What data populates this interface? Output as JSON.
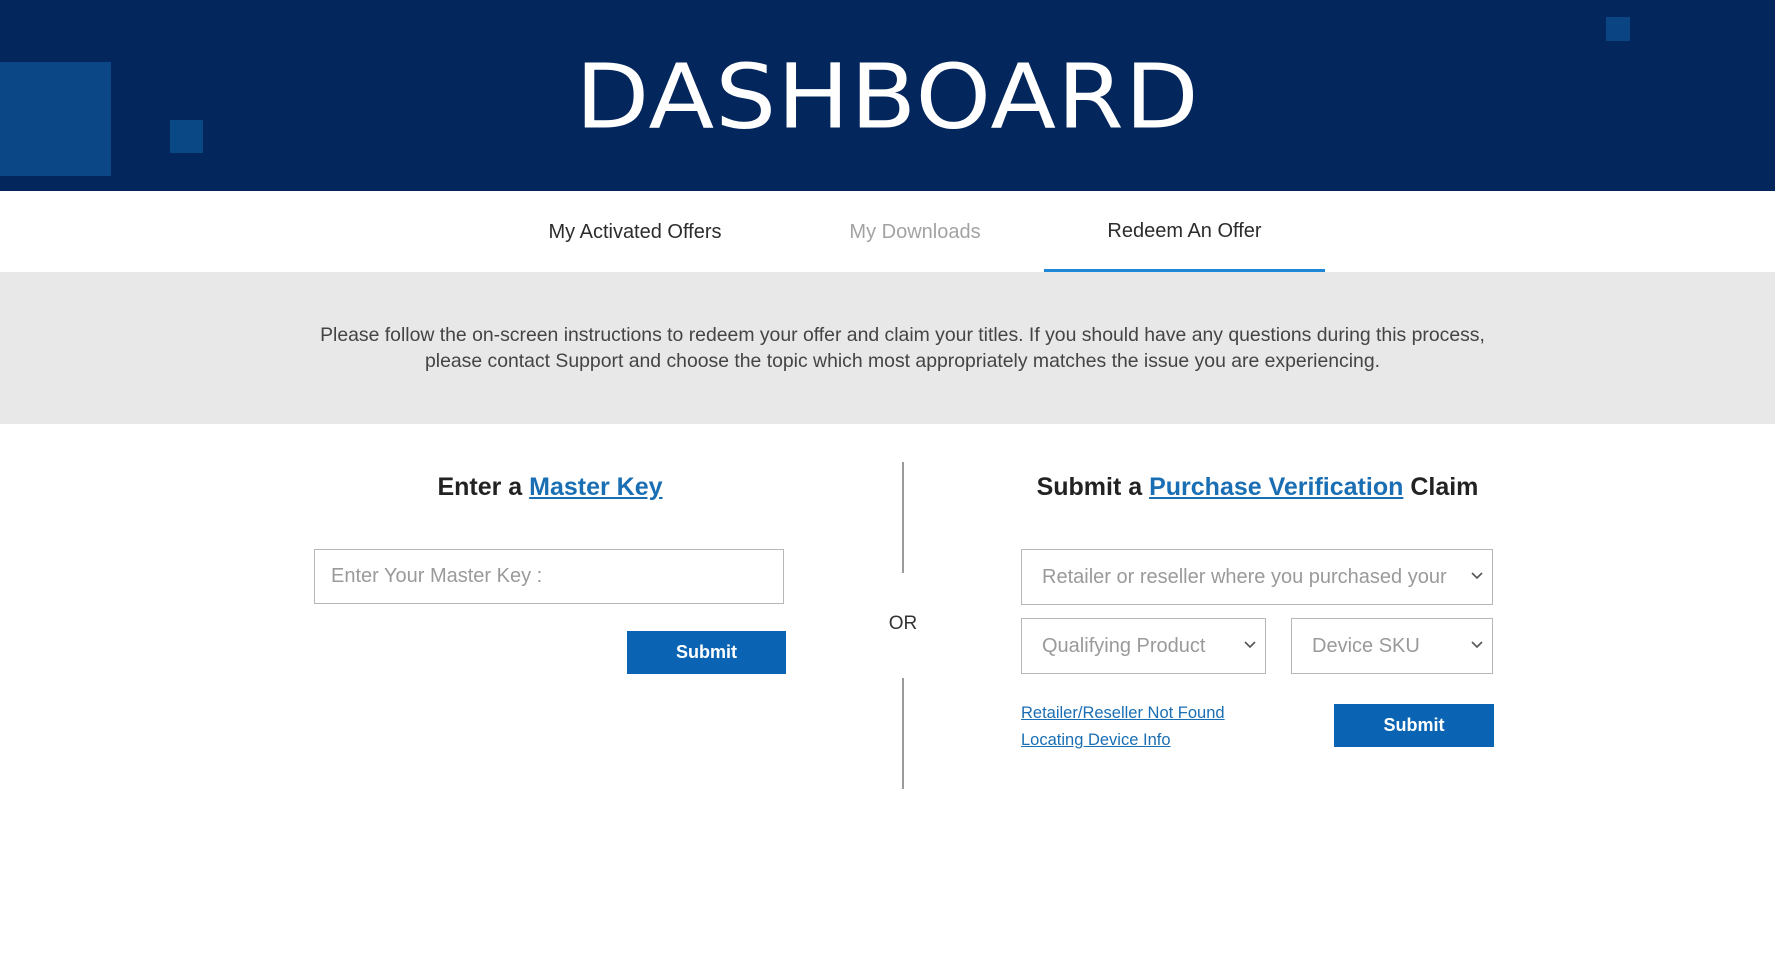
{
  "hero": {
    "title": "DASHBOARD"
  },
  "tabs": [
    {
      "label": "My Activated Offers",
      "state": "normal"
    },
    {
      "label": "My Downloads",
      "state": "disabled"
    },
    {
      "label": "Redeem An Offer",
      "state": "active"
    }
  ],
  "info": {
    "text": "Please follow the on-screen instructions to redeem your offer and claim your titles. If you should have any questions during this process, please contact Support and choose the topic which most appropriately matches the issue you are experiencing."
  },
  "master_key": {
    "heading_prefix": "Enter a ",
    "heading_link": "Master Key",
    "input_placeholder": "Enter Your Master Key :",
    "submit_label": "Submit"
  },
  "divider": {
    "label": "OR"
  },
  "purchase_verification": {
    "heading_prefix": "Submit a ",
    "heading_link": "Purchase Verification",
    "heading_suffix": " Claim",
    "retailer_select": "Retailer or reseller where you purchased your",
    "product_select": "Qualifying Product",
    "sku_select": "Device SKU",
    "link_retailer_not_found": "Retailer/Reseller Not Found",
    "link_locating_device": "Locating Device Info",
    "submit_label": "Submit"
  },
  "colors": {
    "hero_bg": "#03265c",
    "accent": "#0b64b3",
    "link": "#1a6eb3",
    "tab_underline": "#1e88d6"
  }
}
